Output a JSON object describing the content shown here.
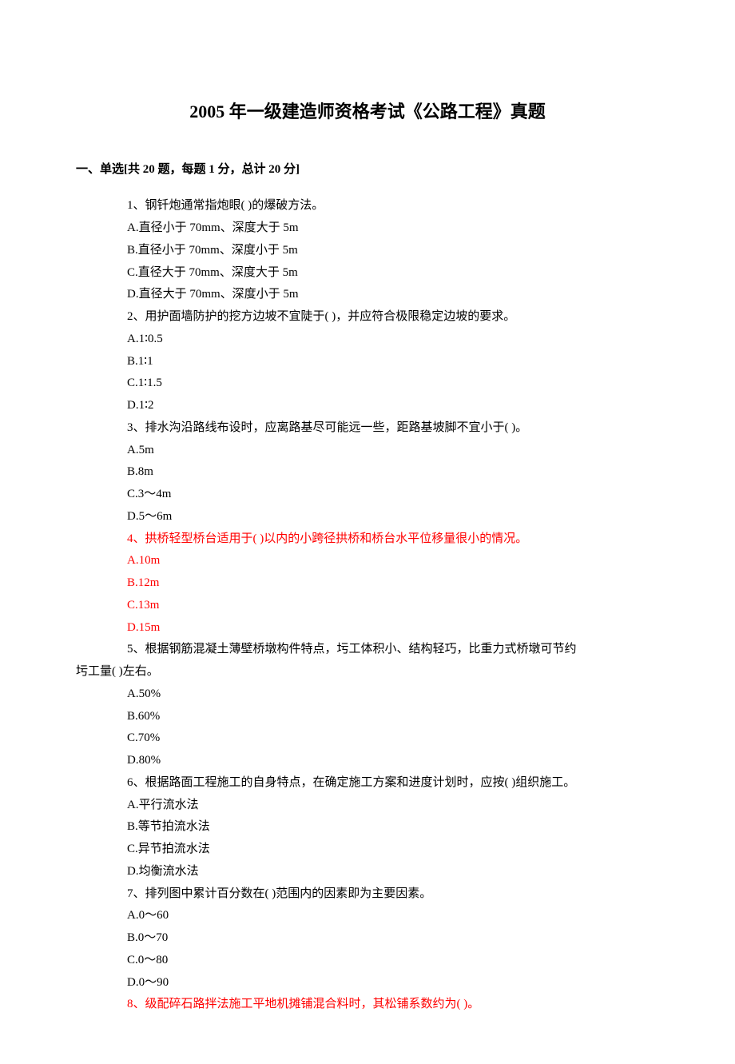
{
  "title": "2005 年一级建造师资格考试《公路工程》真题",
  "section": "一、单选[共 20 题，每题 1 分，总计 20 分]",
  "q1": {
    "stem": "1、钢钎炮通常指炮眼( )的爆破方法。",
    "a": "A.直径小于 70mm、深度大于 5m",
    "b": "B.直径小于 70mm、深度小于 5m",
    "c": "C.直径大于 70mm、深度大于 5m",
    "d": "D.直径大于 70mm、深度小于 5m"
  },
  "q2": {
    "stem": "2、用护面墙防护的挖方边坡不宜陡于( )，并应符合极限稳定边坡的要求。",
    "a": "A.1∶0.5",
    "b": "B.1∶1",
    "c": "C.1∶1.5",
    "d": "D.1∶2"
  },
  "q3": {
    "stem": "3、排水沟沿路线布设时，应离路基尽可能远一些，距路基坡脚不宜小于( )。",
    "a": "A.5m",
    "b": "B.8m",
    "c": "C.3～4m",
    "d": "D.5～6m"
  },
  "q4": {
    "stem": "4、拱桥轻型桥台适用于( )以内的小跨径拱桥和桥台水平位移量很小的情况。",
    "a": "A.10m",
    "b": "B.12m",
    "c": "C.13m",
    "d": "D.15m"
  },
  "q5": {
    "stem": "5、根据钢筋混凝土薄壁桥墩构件特点，圬工体积小、结构轻巧，比重力式桥墩可节约",
    "stem2": "圬工量( )左右。",
    "a": "A.50%",
    "b": "B.60%",
    "c": "C.70%",
    "d": "D.80%"
  },
  "q6": {
    "stem": "6、根据路面工程施工的自身特点，在确定施工方案和进度计划时，应按( )组织施工。",
    "a": "A.平行流水法",
    "b": "B.等节拍流水法",
    "c": "C.异节拍流水法",
    "d": "D.均衡流水法"
  },
  "q7": {
    "stem": "7、排列图中累计百分数在( )范围内的因素即为主要因素。",
    "a": "A.0～60",
    "b": "B.0～70",
    "c": "C.0～80",
    "d": "D.0～90"
  },
  "q8": {
    "stem": "8、级配碎石路拌法施工平地机摊铺混合料时，其松铺系数约为( )。"
  }
}
